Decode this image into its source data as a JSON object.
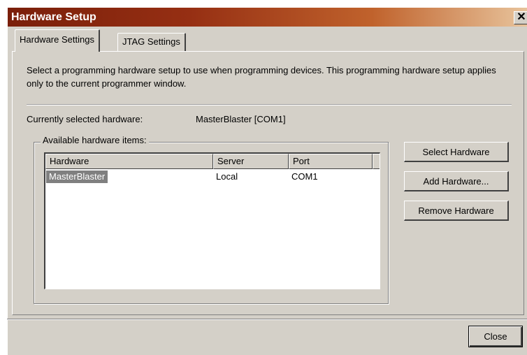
{
  "window": {
    "title": "Hardware Setup",
    "close_glyph": "✕"
  },
  "tabs": [
    {
      "label": "Hardware Settings",
      "active": true
    },
    {
      "label": "JTAG Settings",
      "active": false
    }
  ],
  "description": "Select a programming hardware setup to use when programming devices. This programming hardware setup applies only to the current programmer window.",
  "current_hardware": {
    "label": "Currently selected hardware:",
    "value": "MasterBlaster [COM1]"
  },
  "available": {
    "label": "Available hardware items:",
    "columns": [
      "Hardware",
      "Server",
      "Port"
    ],
    "rows": [
      {
        "hardware": "MasterBlaster",
        "server": "Local",
        "port": "COM1",
        "selected": true
      }
    ]
  },
  "buttons": {
    "select": "Select Hardware",
    "add": "Add Hardware...",
    "remove": "Remove Hardware",
    "close": "Close"
  },
  "colors": {
    "title_start": "#7a1f0a",
    "title_end": "#e8c49c",
    "face": "#d4d0c8",
    "selection": "#808080"
  }
}
